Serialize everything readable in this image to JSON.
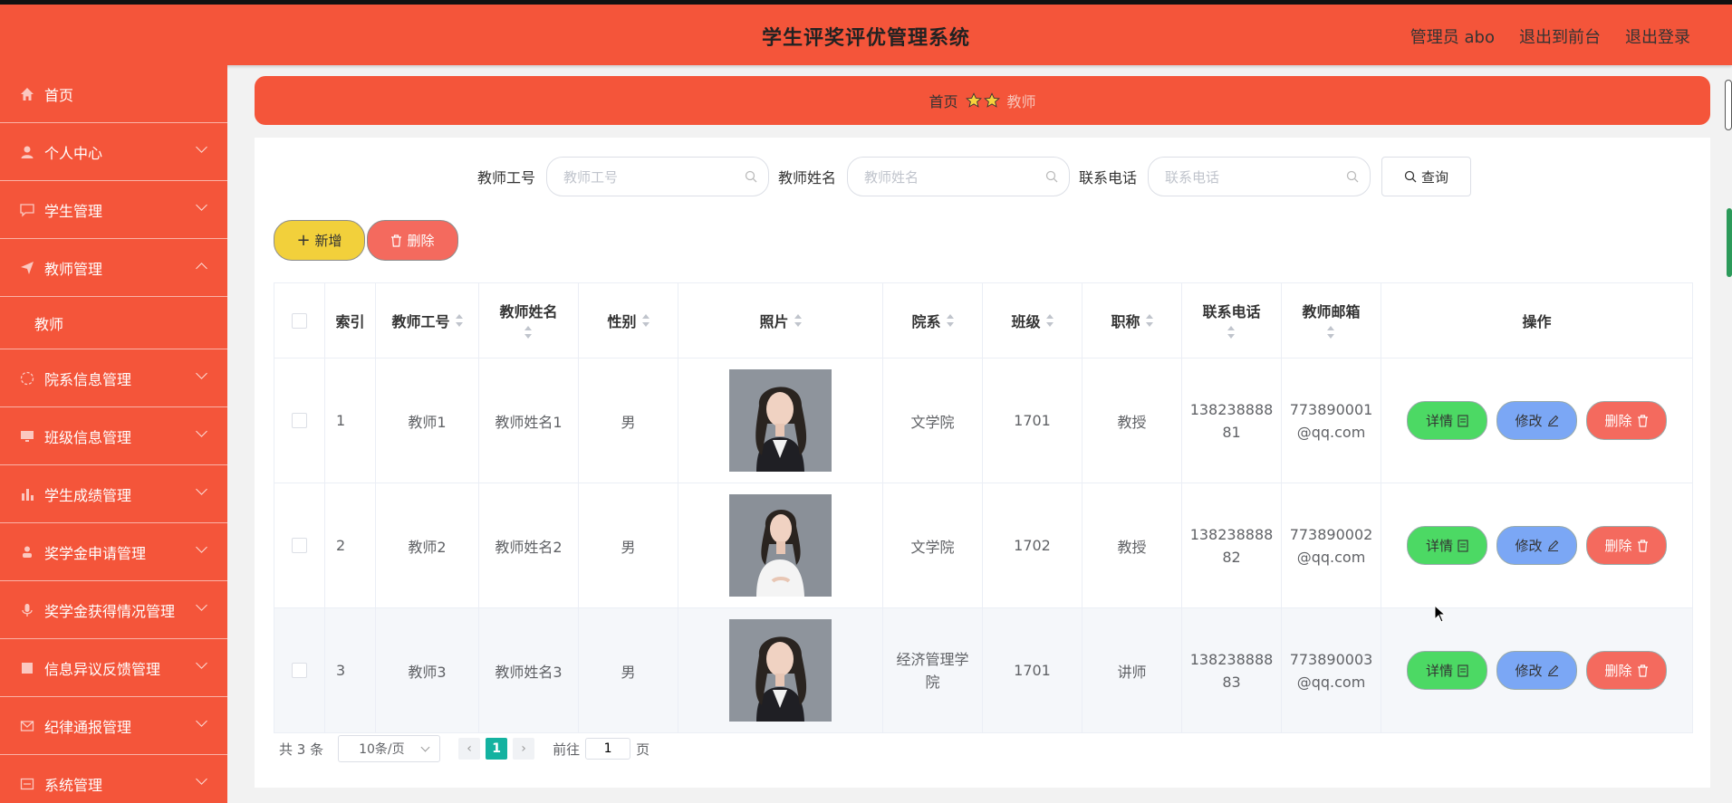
{
  "app": {
    "title": "学生评奖评优管理系统"
  },
  "header": {
    "admin_label": "管理员 abo",
    "to_front": "退出到前台",
    "logout": "退出登录"
  },
  "sidebar": {
    "items": [
      {
        "label": "首页",
        "icon": "home-icon"
      },
      {
        "label": "个人中心",
        "icon": "user-icon"
      },
      {
        "label": "学生管理",
        "icon": "chat-icon"
      },
      {
        "label": "教师管理",
        "icon": "send-icon",
        "expanded": true
      },
      {
        "label": "教师",
        "sub": true
      },
      {
        "label": "院系信息管理",
        "icon": "circle-icon"
      },
      {
        "label": "班级信息管理",
        "icon": "monitor-icon"
      },
      {
        "label": "学生成绩管理",
        "icon": "bar-chart-icon"
      },
      {
        "label": "奖学金申请管理",
        "icon": "person-icon"
      },
      {
        "label": "奖学金获得情况管理",
        "icon": "mic-icon"
      },
      {
        "label": "信息异议反馈管理",
        "icon": "doc-icon"
      },
      {
        "label": "纪律通报管理",
        "icon": "mail-icon"
      },
      {
        "label": "系统管理",
        "icon": "settings-icon"
      }
    ]
  },
  "breadcrumb": {
    "home": "首页",
    "current": "教师"
  },
  "search": {
    "teacher_no_label": "教师工号",
    "teacher_no_placeholder": "教师工号",
    "teacher_name_label": "教师姓名",
    "teacher_name_placeholder": "教师姓名",
    "phone_label": "联系电话",
    "phone_placeholder": "联系电话",
    "query_label": "查询"
  },
  "actions": {
    "add_label": "新增",
    "delete_label": "删除"
  },
  "table": {
    "headers": {
      "index": "索引",
      "teacher_no": "教师工号",
      "teacher_name": "教师姓名",
      "gender": "性别",
      "photo": "照片",
      "department": "院系",
      "class": "班级",
      "title": "职称",
      "phone": "联系电话",
      "email": "教师邮箱",
      "ops": "操作"
    },
    "rows": [
      {
        "index": "1",
        "teacher_no": "教师1",
        "teacher_name": "教师姓名1",
        "gender": "男",
        "department": "文学院",
        "class": "1701",
        "title": "教授",
        "phone_a": "138238888",
        "phone_b": "81",
        "email_a": "773890001",
        "email_b": "@qq.com"
      },
      {
        "index": "2",
        "teacher_no": "教师2",
        "teacher_name": "教师姓名2",
        "gender": "男",
        "department": "文学院",
        "class": "1702",
        "title": "教授",
        "phone_a": "138238888",
        "phone_b": "82",
        "email_a": "773890002",
        "email_b": "@qq.com"
      },
      {
        "index": "3",
        "teacher_no": "教师3",
        "teacher_name": "教师姓名3",
        "gender": "男",
        "department_a": "经济管理学",
        "department_b": "院",
        "class": "1701",
        "title": "讲师",
        "phone_a": "138238888",
        "phone_b": "83",
        "email_a": "773890003",
        "email_b": "@qq.com"
      }
    ],
    "op_labels": {
      "detail": "详情",
      "edit": "修改",
      "delete": "删除"
    }
  },
  "pagination": {
    "total": "共 3 条",
    "page_size": "10条/页",
    "current_page": "1",
    "goto_prefix": "前往",
    "goto_value": "1",
    "goto_suffix": "页"
  },
  "colors": {
    "brand": "#f4553a",
    "add": "#f2d03b",
    "delete": "#f46a5e",
    "detail": "#4cd964",
    "edit": "#7ba7f5",
    "page_active": "#14b2a0"
  }
}
